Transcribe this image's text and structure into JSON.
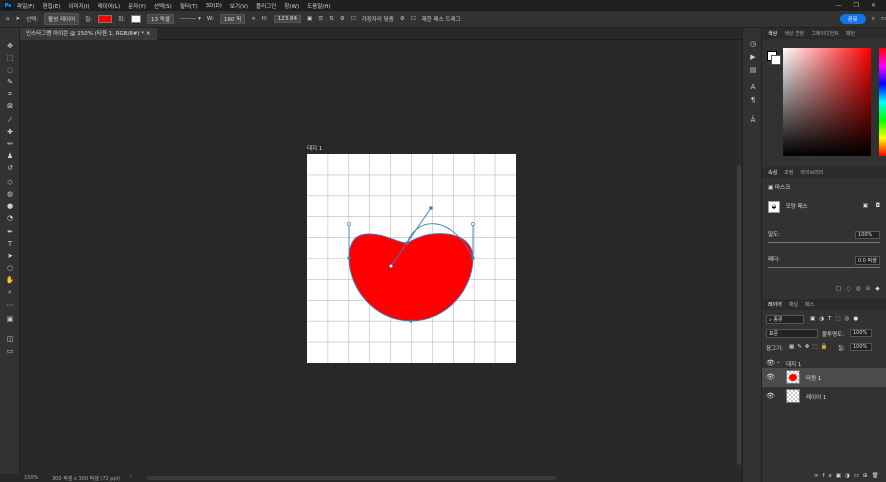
{
  "menubar": {
    "logo": "Ps",
    "items": [
      "파일(F)",
      "편집(E)",
      "이미지(I)",
      "레이어(L)",
      "문자(Y)",
      "선택(S)",
      "필터(T)",
      "3D(D)",
      "보기(V)",
      "플러그인",
      "창(W)",
      "도움말(H)"
    ],
    "window_controls": [
      "—",
      "❐",
      "✕"
    ]
  },
  "options": {
    "mode_label": "선택:",
    "mode_value": "활성 레이어",
    "fill_label": "칠:",
    "stroke_label": "획:",
    "stroke_width": "13 픽셀",
    "w_label": "W:",
    "w_value": "180 픽",
    "h_label": "H:",
    "h_value": "123.84",
    "align_edges": "가장자리 맞춤",
    "constrain_path": "제한 패스 드래그",
    "share": "공유",
    "fill_color": "#ff0000"
  },
  "document": {
    "tab_title": "인스타그램 아이콘 @ 150% (타원 1, RGB/8#) *",
    "artboard_label": "대지 1",
    "zoom": "150%",
    "size_info": "300 픽셀 x 300 픽셀 (72 ppi)"
  },
  "color_panel": {
    "tabs": [
      "색상",
      "색상 견본",
      "그레이디언트",
      "패턴"
    ]
  },
  "properties_panel": {
    "tabs": [
      "속성",
      "조정",
      "라이브러리"
    ],
    "mask_label": "마스크",
    "shape_mask": "모양 패스",
    "density_label": "밀도:",
    "density_value": "100%",
    "feather_label": "페더:",
    "feather_value": "0.0 픽셀"
  },
  "layers_panel": {
    "tabs": [
      "레이어",
      "채널",
      "패스"
    ],
    "filter_kind": "종류",
    "blend_mode": "표준",
    "opacity_label": "불투명도:",
    "opacity_value": "100%",
    "lock_label": "잠그기:",
    "fill_label": "칠:",
    "fill_value": "100%",
    "group": "대지 1",
    "layers": [
      "타원 1",
      "레이어 1"
    ]
  }
}
